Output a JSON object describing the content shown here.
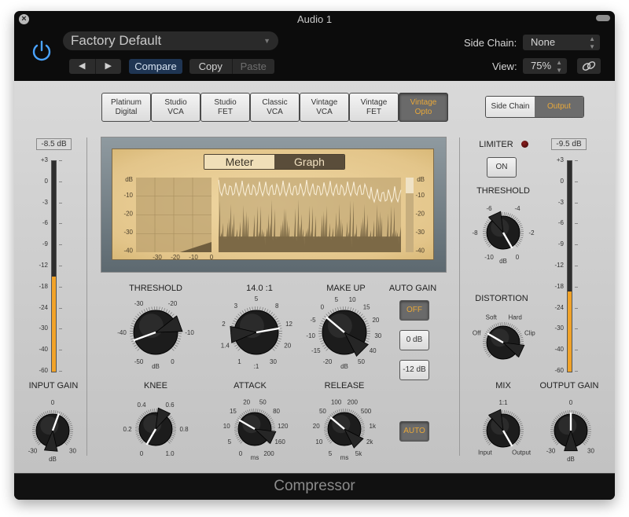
{
  "window": {
    "title": "Audio 1",
    "footer_title": "Compressor"
  },
  "header": {
    "preset": "Factory Default",
    "compare_label": "Compare",
    "copy_label": "Copy",
    "paste_label": "Paste",
    "prev_glyph": "◀",
    "next_glyph": "▶",
    "side_chain_label": "Side Chain:",
    "side_chain_value": "None",
    "view_label": "View:",
    "view_value": "75%",
    "icons": [
      "close-icon",
      "power-icon",
      "prev-icon",
      "next-icon",
      "link-icon"
    ]
  },
  "colors": {
    "accent_orange": "#e8a83a",
    "meter_fill": "#f1a329",
    "power_blue": "#4aa3ff",
    "compare_bg": "#1f3553"
  },
  "circuit_types": {
    "selected": "Vintage Opto",
    "items": [
      {
        "line1": "Platinum",
        "line2": "Digital",
        "active": false
      },
      {
        "line1": "Studio",
        "line2": "VCA",
        "active": false
      },
      {
        "line1": "Studio",
        "line2": "FET",
        "active": false
      },
      {
        "line1": "Classic",
        "line2": "VCA",
        "active": false
      },
      {
        "line1": "Vintage",
        "line2": "VCA",
        "active": false
      },
      {
        "line1": "Vintage",
        "line2": "FET",
        "active": false
      },
      {
        "line1": "Vintage",
        "line2": "Opto",
        "active": true
      }
    ]
  },
  "output_toggle": {
    "side_chain_label": "Side Chain",
    "output_label": "Output",
    "selected": "Output"
  },
  "meter_scale": [
    "+3",
    "0",
    "-3",
    "-6",
    "-9",
    "-12",
    "-18",
    "-24",
    "-30",
    "-40",
    "-60"
  ],
  "input_meter": {
    "readout": "-8.5 dB",
    "level_fraction": 0.45
  },
  "output_meter": {
    "readout": "-9.5 dB",
    "level_fraction": 0.38
  },
  "display": {
    "meter_tab": "Meter",
    "graph_tab": "Graph",
    "selected_tab": "Graph",
    "db_label": "dB",
    "left_y_ticks": [
      "-10",
      "-20",
      "-30",
      "-40"
    ],
    "x_ticks": [
      "-30",
      "-20",
      "-10",
      "0"
    ],
    "right_y_ticks": [
      "-10",
      "-20",
      "-30",
      "-40"
    ]
  },
  "knobs": {
    "threshold": {
      "label": "THRESHOLD",
      "unit": "dB",
      "scale": [
        "-50",
        "-40",
        "-30",
        "-20",
        "-10",
        "0"
      ],
      "value": -42
    },
    "ratio": {
      "label": "14.0 :1",
      "unit": ":1",
      "scale": [
        "1",
        "1.4",
        "2",
        "3",
        "5",
        "8",
        "12",
        "20",
        "30"
      ],
      "value": 14.0
    },
    "makeup": {
      "label": "MAKE UP",
      "unit": "dB",
      "scale": [
        "-20",
        "-15",
        "-10",
        "-5",
        "0",
        "5",
        "10",
        "15",
        "20",
        "30",
        "40",
        "50"
      ],
      "value": -2
    },
    "knee": {
      "label": "KNEE",
      "scale": [
        "0",
        "0.2",
        "0.4",
        "0.6",
        "0.8",
        "1.0"
      ],
      "value": 0.0
    },
    "attack": {
      "label": "ATTACK",
      "unit": "ms",
      "scale": [
        "0",
        "5",
        "10",
        "15",
        "20",
        "50",
        "80",
        "120",
        "160",
        "200"
      ],
      "value": 15
    },
    "release": {
      "label": "RELEASE",
      "unit": "ms",
      "scale": [
        "5",
        "10",
        "20",
        "50",
        "100",
        "200",
        "500",
        "1k",
        "2k",
        "5k"
      ],
      "value": 50
    },
    "input_gain": {
      "label": "INPUT GAIN",
      "unit": "dB",
      "scale": [
        "-30",
        "0",
        "30"
      ],
      "value": 3
    },
    "output_gain": {
      "label": "OUTPUT GAIN",
      "unit": "dB",
      "scale": [
        "-30",
        "0",
        "30"
      ],
      "value": 0
    },
    "limiter_threshold": {
      "label": "THRESHOLD",
      "unit": "dB",
      "scale": [
        "-10",
        "-8",
        "-6",
        "-4",
        "-2",
        "0"
      ],
      "value": 0
    },
    "distortion": {
      "label": "DISTORTION",
      "scale": [
        "Off",
        "Soft",
        "Hard",
        "Clip"
      ],
      "value": "Off"
    },
    "mix": {
      "label": "MIX",
      "scale": [
        "Input",
        "1:1",
        "Output"
      ],
      "value": "Output"
    }
  },
  "auto_gain": {
    "label": "AUTO GAIN",
    "off_label": "OFF",
    "zero_label": "0 dB",
    "minus12_label": "-12 dB",
    "selected": "OFF"
  },
  "auto_release": {
    "label": "AUTO",
    "active": true
  },
  "limiter": {
    "label": "LIMITER",
    "on_label": "ON"
  }
}
